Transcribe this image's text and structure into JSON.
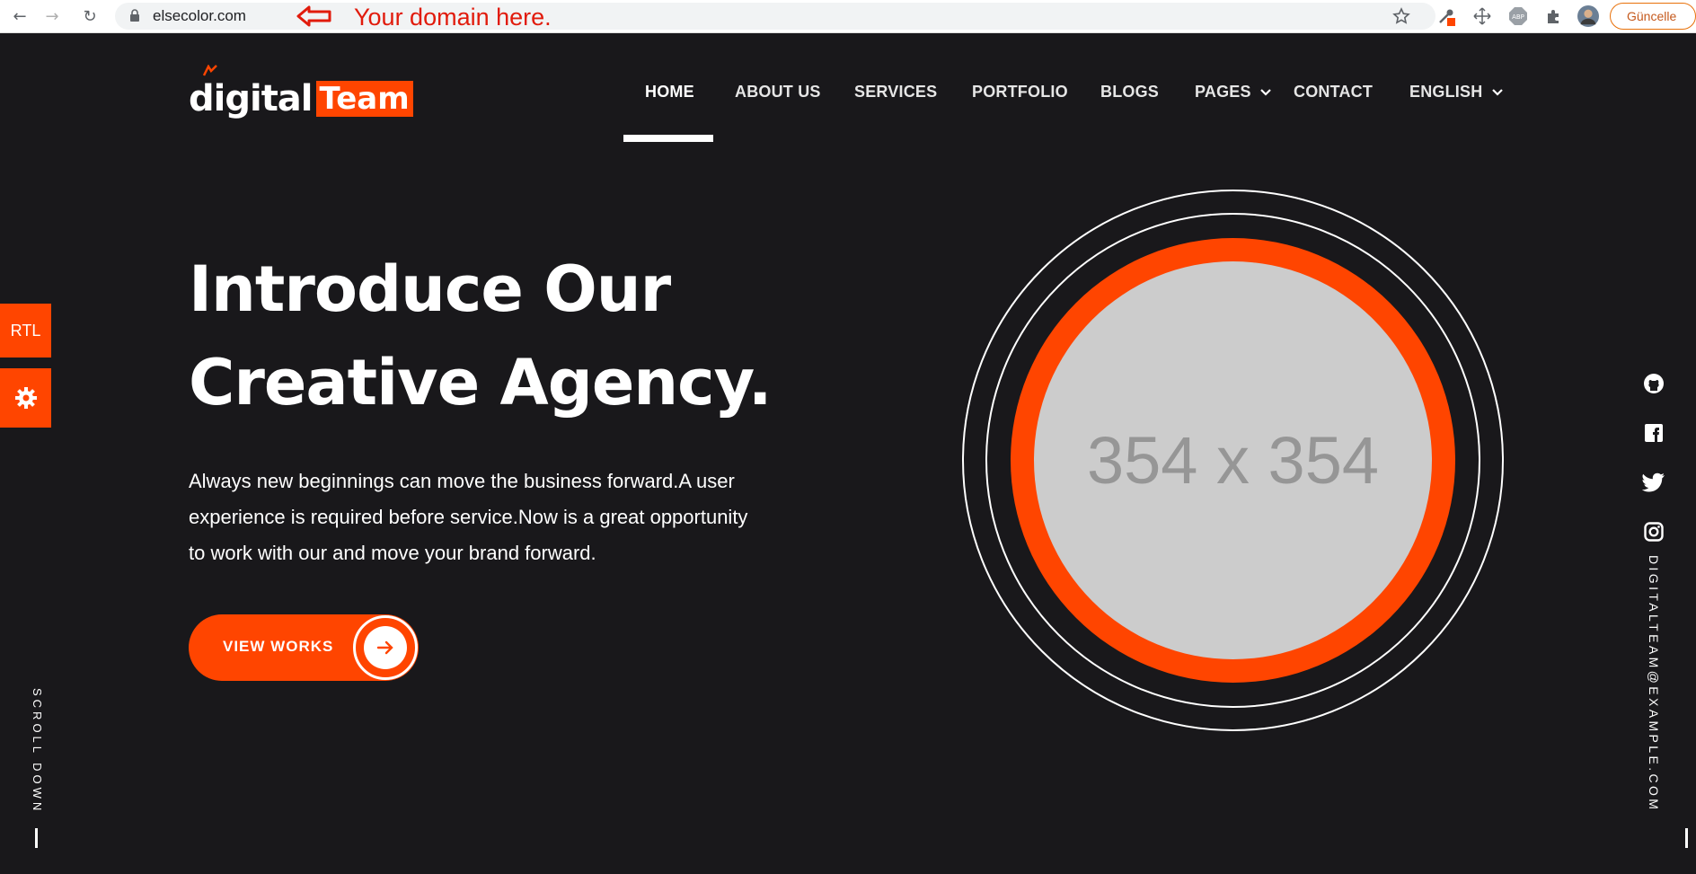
{
  "browser": {
    "url": "elsecolor.com",
    "annotation": "Your domain here.",
    "update_button": "Güncelle"
  },
  "site": {
    "logo": {
      "word1": "digital",
      "word2": "Team"
    },
    "nav": [
      {
        "label": "HOME",
        "active": true
      },
      {
        "label": "ABOUT US"
      },
      {
        "label": "SERVICES"
      },
      {
        "label": "PORTFOLIO"
      },
      {
        "label": "BLOGS"
      },
      {
        "label": "PAGES",
        "dropdown": true
      },
      {
        "label": "CONTACT"
      },
      {
        "label": "ENGLISH",
        "dropdown": true
      }
    ]
  },
  "hero": {
    "title_line1": "Introduce Our",
    "title_line2": "Creative Agency.",
    "description": "Always new beginnings can move the business forward.A user experience is required before service.Now is a great opportunity to work with our and move your brand forward.",
    "cta_label": "VIEW WORKS",
    "image_placeholder": "354 x 354"
  },
  "sidebar_left": {
    "rtl_label": "RTL",
    "settings_icon": "gear-icon",
    "scroll_text": "SCROLL DOWN"
  },
  "sidebar_right": {
    "socials": [
      "github-icon",
      "facebook-icon",
      "twitter-icon",
      "instagram-icon"
    ],
    "email": "DIGITALTEAM@EXAMPLE.COM"
  },
  "colors": {
    "accent": "#ff4500",
    "background": "#19181b",
    "placeholder": "#cccccc"
  }
}
